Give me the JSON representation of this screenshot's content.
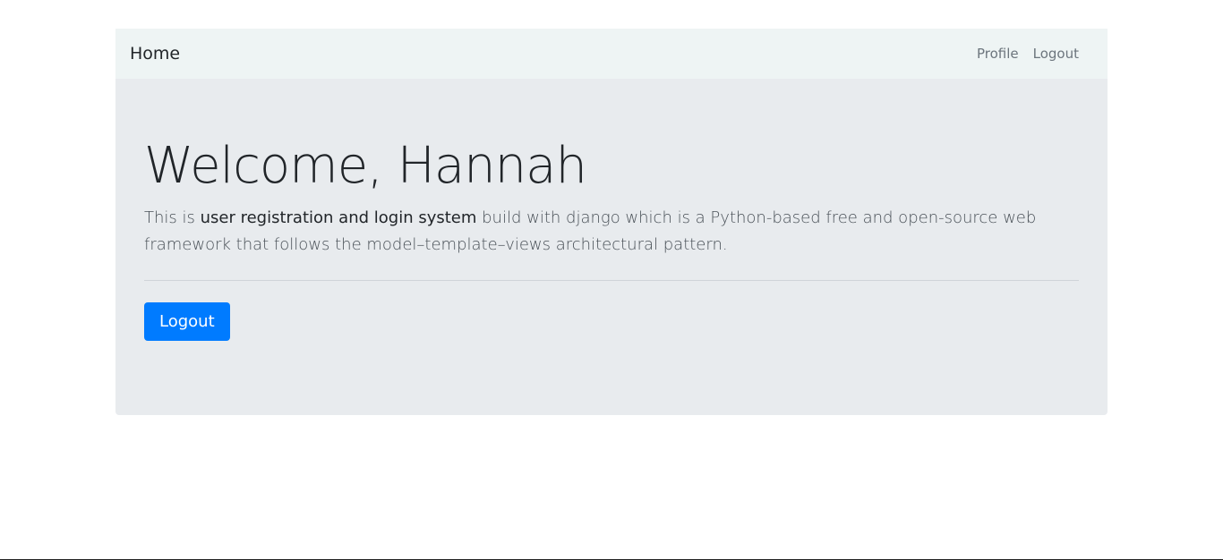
{
  "navbar": {
    "brand": "Home",
    "links": [
      "Profile",
      "Logout"
    ]
  },
  "jumbotron": {
    "heading": "Welcome, Hannah",
    "lead_prefix": "This is ",
    "lead_bold": "user registration and login system",
    "lead_suffix": " build with django which is a Python-based free and open-source web framework that follows the model–template–views architectural pattern.",
    "button_label": "Logout"
  },
  "colors": {
    "primary": "#007bff",
    "navbar_bg": "#eef4f4",
    "jumbotron_bg": "#e8ebee"
  }
}
